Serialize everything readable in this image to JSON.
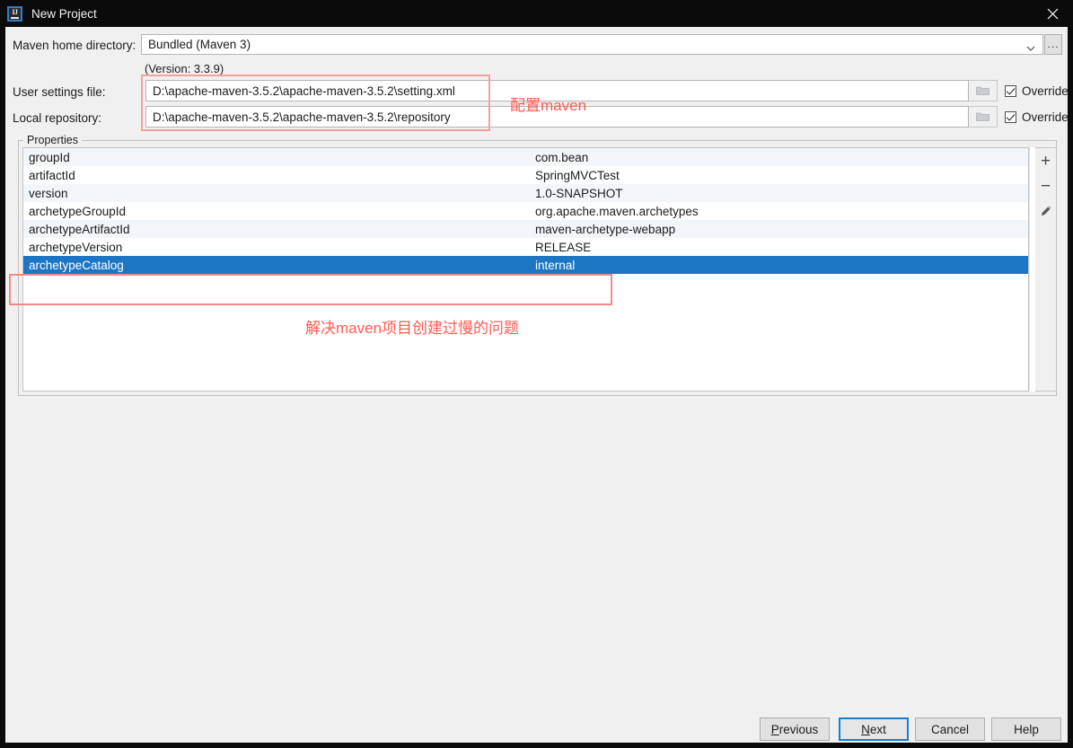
{
  "window": {
    "title": "New Project",
    "app_icon": "intellij-idea-icon",
    "close_icon": "close-icon"
  },
  "form": {
    "maven_home": {
      "label": "Maven home directory:",
      "value": "Bundled (Maven 3)",
      "chevron_icon": "chevron-down-icon",
      "ellipsis_label": "...",
      "version_note": "(Version: 3.3.9)"
    },
    "user_settings": {
      "label": "User settings file:",
      "value": "D:\\apache-maven-3.5.2\\apache-maven-3.5.2\\setting.xml",
      "browse_icon": "folder-icon",
      "override_label": "Override",
      "override_checked": true
    },
    "local_repository": {
      "label": "Local repository:",
      "value": "D:\\apache-maven-3.5.2\\apache-maven-3.5.2\\repository",
      "browse_icon": "folder-icon",
      "override_label": "Override",
      "override_checked": true
    }
  },
  "properties": {
    "group_title": "Properties",
    "rows": [
      {
        "key": "groupId",
        "value": "com.bean"
      },
      {
        "key": "artifactId",
        "value": "SpringMVCTest"
      },
      {
        "key": "version",
        "value": "1.0-SNAPSHOT"
      },
      {
        "key": "archetypeGroupId",
        "value": "org.apache.maven.archetypes"
      },
      {
        "key": "archetypeArtifactId",
        "value": "maven-archetype-webapp"
      },
      {
        "key": "archetypeVersion",
        "value": "RELEASE"
      },
      {
        "key": "archetypeCatalog",
        "value": "internal"
      }
    ],
    "selected_row_index": 6,
    "toolbar": {
      "add_label": "+",
      "remove_label": "−",
      "edit_icon": "pencil-icon"
    }
  },
  "annotations": {
    "maven_config": "配置maven",
    "archetype_note": "解决maven项目创建过慢的问题",
    "color": "#ff5b52",
    "box_color": "#f4a0a0"
  },
  "footer": {
    "previous": {
      "prefix": "",
      "mnemonic": "P",
      "suffix": "revious"
    },
    "next": {
      "prefix": "",
      "mnemonic": "N",
      "suffix": "ext"
    },
    "cancel": {
      "prefix": "Cancel",
      "mnemonic": "",
      "suffix": ""
    },
    "help": {
      "prefix": "Help",
      "mnemonic": "",
      "suffix": ""
    }
  }
}
